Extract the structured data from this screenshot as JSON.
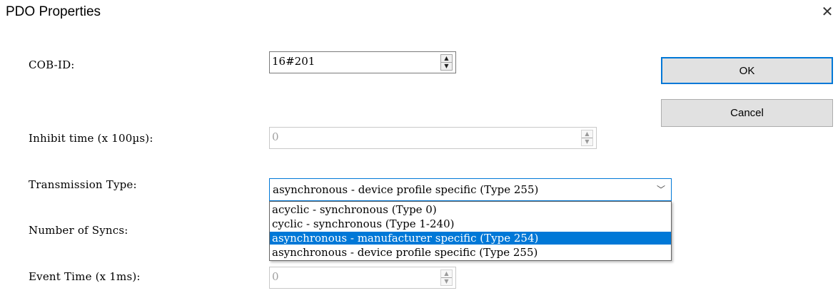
{
  "window": {
    "title": "PDO Properties",
    "close_glyph": "✕"
  },
  "fields": {
    "cob_id": {
      "label": "COB-ID:",
      "value": "16#201"
    },
    "inhibit_time": {
      "label": "Inhibit time (x 100µs):",
      "value": "0"
    },
    "transmission_type": {
      "label": "Transmission Type:",
      "value": "asynchronous - device profile specific (Type 255)"
    },
    "number_of_syncs": {
      "label": "Number of Syncs:"
    },
    "event_time": {
      "label": "Event Time (x 1ms):",
      "value": "0"
    }
  },
  "dropdown": {
    "options": [
      "acyclic - synchronous (Type 0)",
      "cyclic - synchronous (Type 1-240)",
      "asynchronous - manufacturer specific (Type 254)",
      "asynchronous - device profile specific (Type 255)"
    ],
    "highlighted_index": 2
  },
  "buttons": {
    "ok": "OK",
    "cancel": "Cancel"
  },
  "icons": {
    "close": "close-icon",
    "spin": "spinner-arrows-icon",
    "chevron": "chevron-down-icon"
  },
  "colors": {
    "accent": "#0078d7",
    "button_face": "#e1e1e1",
    "disabled_text": "#a0a0a0"
  }
}
